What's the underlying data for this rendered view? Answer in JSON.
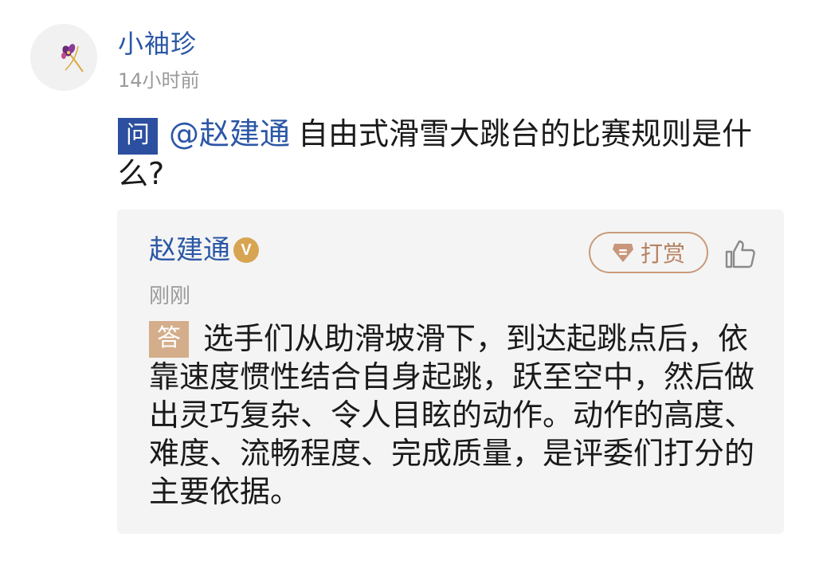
{
  "user": {
    "name": "小袖珍",
    "time": "14小时前",
    "avatar": "flower-avatar"
  },
  "question": {
    "badge": "问",
    "mention": "@赵建通",
    "text": "自由式滑雪大跳台的比赛规则是什么?"
  },
  "answer": {
    "answerer_name": "赵建通",
    "verified_badge": "V",
    "reward_label": "打赏",
    "time": "刚刚",
    "badge": "答",
    "text": "选手们从助滑坡滑下，到达起跳点后，依靠速度惯性结合自身起跳，跃至空中，然后做出灵巧复杂、令人目眩的动作。动作的高度、难度、流畅程度、完成质量，是评委们打分的主要依据。"
  },
  "icons": {
    "reward": "gem-icon",
    "like": "thumbs-up-icon"
  },
  "colors": {
    "link_blue": "#2b57a6",
    "question_badge": "#2c4fa0",
    "answer_badge": "#d4ad8a",
    "reward_accent": "#c89a79",
    "card_background": "#f4f4f4"
  }
}
